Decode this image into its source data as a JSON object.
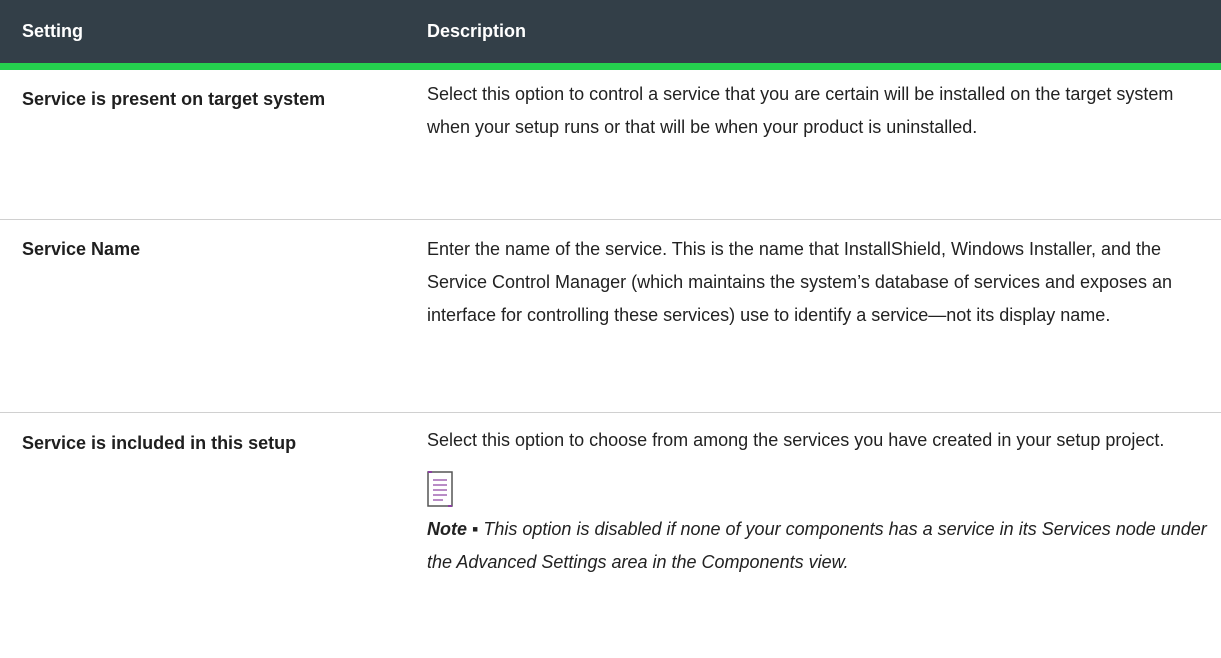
{
  "header": {
    "col_setting": "Setting",
    "col_description": "Description"
  },
  "rows": [
    {
      "setting": "Service is present on target system",
      "description": "Select this option to control a service that you are certain will be installed on the target system when your setup runs or that will be when your product is uninstalled."
    },
    {
      "setting": "Service Name",
      "description": "Enter the name of the service. This is the name that InstallShield, Windows Installer, and the Service Control Manager (which maintains the system’s database of services and exposes an interface for controlling these services) use to identify a service—not its display name."
    },
    {
      "setting": "Service is included in this setup",
      "description": "Select this option to choose from among the services you have created in your setup project.",
      "note_icon": "note-icon",
      "note_label": "Note ▪",
      "note_text": " This option is disabled if none of your components has a service in its Services node under the Advanced Settings area in the Components view."
    }
  ],
  "colors": {
    "header_bg": "#333f48",
    "header_accent": "#25d04e",
    "icon_accent": "#8a3fa0"
  }
}
